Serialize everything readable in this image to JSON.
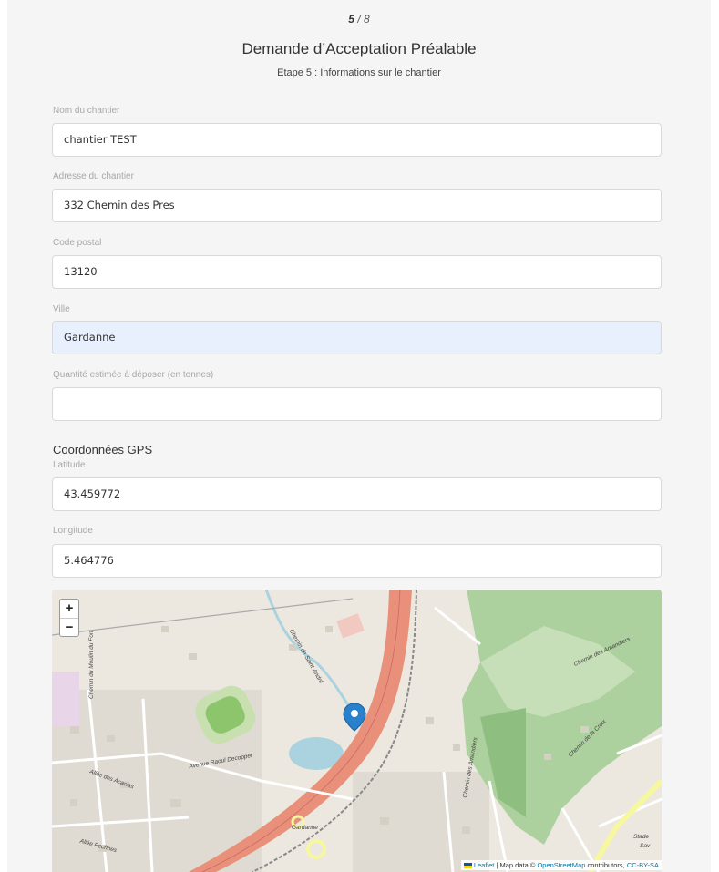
{
  "header": {
    "step_current": "5",
    "step_total": "8",
    "title": "Demande d’Acceptation Préalable",
    "subtitle": "Etape 5 : Informations sur le chantier"
  },
  "form": {
    "nom_label": "Nom du chantier",
    "nom_value": "chantier TEST",
    "adresse_label": "Adresse du chantier",
    "adresse_value": "332 Chemin des Pres",
    "cp_label": "Code postal",
    "cp_value": "13120",
    "ville_label": "Ville",
    "ville_value": "Gardanne",
    "quantite_label": "Quantité estimée à déposer (en tonnes)",
    "quantite_value": "",
    "gps_title": "Coordonnées GPS",
    "lat_label": "Latitude",
    "lat_value": "43.459772",
    "lng_label": "Longitude",
    "lng_value": "5.464776"
  },
  "map": {
    "zoom_in": "+",
    "zoom_out": "−",
    "attrib_leaflet": "Leaflet",
    "attrib_sep": " | Map data © ",
    "attrib_osm": "OpenStreetMap",
    "attrib_contrib": " contributors, ",
    "attrib_license": "CC-BY-SA",
    "labels": {
      "moulin": "Chemin du Moulin du Fort",
      "acacias": "Allée des Acacias",
      "raoul": "Avenue Raoul Decoppet",
      "pechnes": "Allée Pechnes",
      "gardanne": "Gardanne",
      "amandiers": "Chemin des Amandiers",
      "amandiers2": "Chemin des Amandiers",
      "saint_andre": "Chemin de Saint-André",
      "lorraine": "Chemin de la Croix",
      "stade": "Stade",
      "sav": "Sav"
    },
    "colors": {
      "highway": "#e8907a",
      "water": "#aad3df",
      "forest": "#add19e",
      "pitch": "#8dc56c",
      "marker": "#2a81cb"
    }
  }
}
